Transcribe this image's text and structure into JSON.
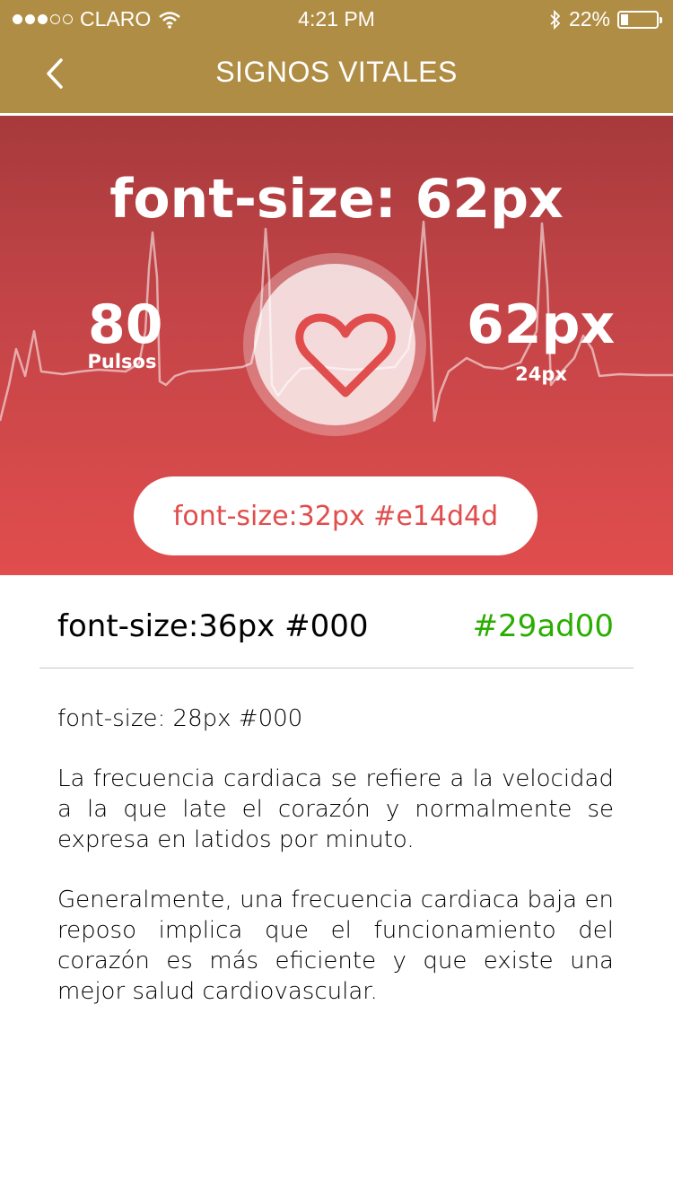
{
  "status_bar": {
    "carrier": "CLARO",
    "time": "4:21 PM",
    "battery": "22%",
    "battery_level": 0.22,
    "signal_bars": 3
  },
  "nav": {
    "title": "SIGNOS VITALES",
    "back_icon": "chevron-left-icon"
  },
  "hero": {
    "title": "font-size: 62px",
    "left_value": "80",
    "left_label": "Pulsos",
    "right_value": "62px",
    "right_label": "24px",
    "center_icon": "heart-icon",
    "button_label": "font-size:32px #e14d4d"
  },
  "detail": {
    "label": "font-size:36px #000",
    "value": "#29ad00"
  },
  "body": {
    "note": "font-size: 28px #000",
    "paragraph_1": "La frecuencia cardiaca se refiere a la velocidad a la que late el corazón y normalmente se expresa en latidos por minuto.",
    "paragraph_2": "Generalmente, una frecuencia cardiaca baja en reposo implica que el funcionamiento del corazón es más eficiente y que existe una mejor salud cardiovascular."
  },
  "colors": {
    "nav_bg": "#b08d44",
    "accent_red": "#e14d4d",
    "accent_green": "#29ad00"
  }
}
